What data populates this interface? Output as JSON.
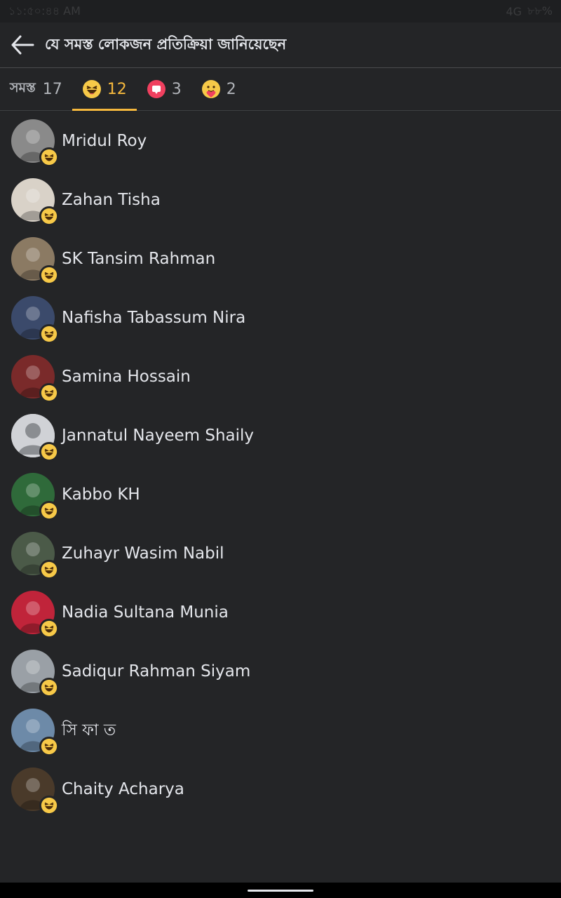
{
  "status_bar": {
    "time": "১১:৫০:৪৪ AM",
    "network": "4G",
    "battery": "৮৮%"
  },
  "header": {
    "title": "যে সমস্ত লোকজন প্রতিক্রিয়া জানিয়েছেন"
  },
  "tabs": [
    {
      "label": "সমস্ত",
      "count": "17",
      "icon": "none"
    },
    {
      "label": "",
      "count": "12",
      "icon": "haha-icon"
    },
    {
      "label": "",
      "count": "3",
      "icon": "love-icon"
    },
    {
      "label": "",
      "count": "2",
      "icon": "care-icon"
    }
  ],
  "people": [
    {
      "name": "Mridul Roy",
      "avatar_color": "#8a8a8a"
    },
    {
      "name": "Zahan Tisha",
      "avatar_color": "#d9d2c8"
    },
    {
      "name": "SK Tansim Rahman",
      "avatar_color": "#8b7a63"
    },
    {
      "name": "Nafisha Tabassum Nira",
      "avatar_color": "#3b4a6b"
    },
    {
      "name": "Samina Hossain",
      "avatar_color": "#7a2a2a"
    },
    {
      "name": "Jannatul Nayeem Shaily",
      "avatar_color": "#d0d2d6"
    },
    {
      "name": "Kabbo KH",
      "avatar_color": "#2f6a3a"
    },
    {
      "name": "Zuhayr Wasim Nabil",
      "avatar_color": "#4b5a48"
    },
    {
      "name": "Nadia Sultana Munia",
      "avatar_color": "#c0243a"
    },
    {
      "name": "Sadiqur Rahman Siyam",
      "avatar_color": "#9aa0a6"
    },
    {
      "name": "সি ফা ত",
      "avatar_color": "#6d8aa8"
    },
    {
      "name": "Chaity Acharya",
      "avatar_color": "#4a3a2a"
    }
  ],
  "colors": {
    "background": "#242527",
    "accent": "#f5b83d",
    "text": "#e4e6eb"
  }
}
